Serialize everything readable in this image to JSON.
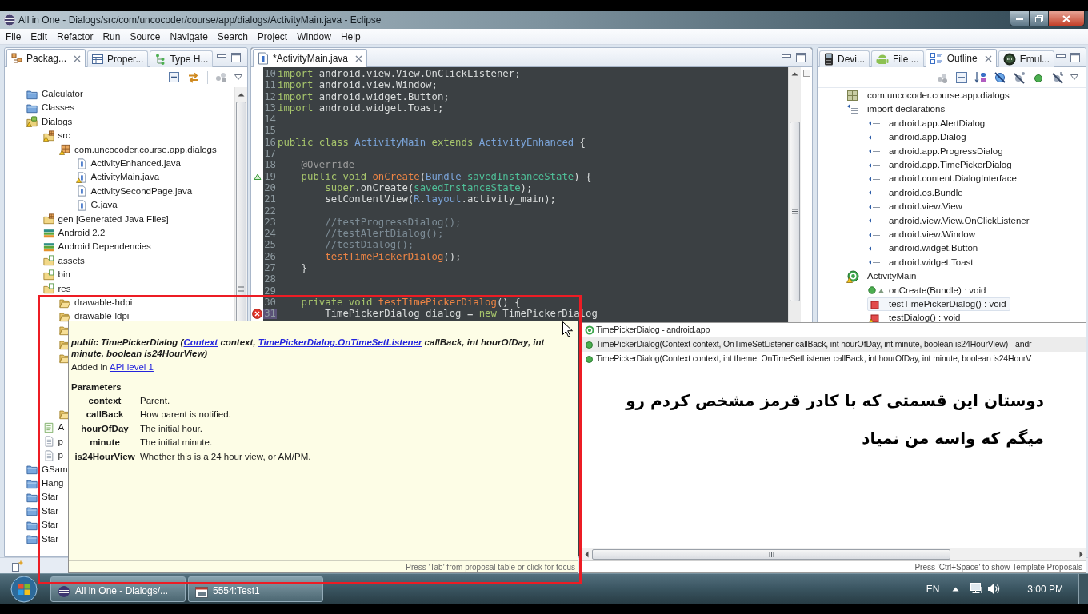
{
  "window": {
    "title": "All in One - Dialogs/src/com/uncocoder/course/app/dialogs/ActivityMain.java - Eclipse"
  },
  "menu_bar": [
    "File",
    "Edit",
    "Refactor",
    "Run",
    "Source",
    "Navigate",
    "Search",
    "Project",
    "Window",
    "Help"
  ],
  "package_explorer": {
    "tabs": [
      {
        "label": "Packag...",
        "kind": "packages",
        "selected": true
      },
      {
        "label": "Proper...",
        "kind": "properties",
        "selected": false
      },
      {
        "label": "Type H...",
        "kind": "hierarchy",
        "selected": false
      }
    ],
    "tree": [
      {
        "label": "Calculator",
        "kind": "project",
        "warning": false
      },
      {
        "label": "Classes",
        "kind": "project",
        "warning": false
      },
      {
        "label": "Dialogs",
        "kind": "android-project",
        "warning": true,
        "children": [
          {
            "label": "src",
            "kind": "source-folder",
            "warning": true,
            "children": [
              {
                "label": "com.uncocoder.course.app.dialogs",
                "kind": "package",
                "warning": true,
                "children": [
                  {
                    "label": "ActivityEnhanced.java",
                    "kind": "java-file",
                    "warning": false
                  },
                  {
                    "label": "ActivityMain.java",
                    "kind": "java-file",
                    "warning": true
                  },
                  {
                    "label": "ActivitySecondPage.java",
                    "kind": "java-file",
                    "warning": false
                  },
                  {
                    "label": "G.java",
                    "kind": "java-file",
                    "warning": false
                  }
                ]
              }
            ]
          },
          {
            "label": "gen [Generated Java Files]",
            "kind": "source-folder",
            "warning": false
          },
          {
            "label": "Android 2.2",
            "kind": "library",
            "warning": false
          },
          {
            "label": "Android Dependencies",
            "kind": "library",
            "warning": false
          },
          {
            "label": "assets",
            "kind": "resource-folder",
            "warning": false
          },
          {
            "label": "bin",
            "kind": "resource-folder",
            "warning": false
          },
          {
            "label": "res",
            "kind": "resource-folder",
            "warning": false,
            "children": [
              {
                "label": "drawable-hdpi",
                "kind": "folder",
                "warning": false
              },
              {
                "label": "drawable-ldpi",
                "kind": "folder",
                "warning": false
              },
              {
                "kind": "folder",
                "warning": false
              },
              {
                "kind": "folder",
                "warning": false
              },
              {
                "kind": "folder",
                "warning": false
              },
              {
                "kind": "folder",
                "warning": false
              }
            ]
          },
          {
            "label": "A",
            "kind": "manifest",
            "warning": false
          },
          {
            "label": "p",
            "kind": "file",
            "warning": false
          },
          {
            "label": "p",
            "kind": "file",
            "warning": false
          }
        ]
      },
      {
        "label": "GSam",
        "kind": "project",
        "warning": false
      },
      {
        "label": "Hang",
        "kind": "project",
        "warning": false
      },
      {
        "label": "Star",
        "kind": "project",
        "warning": false
      },
      {
        "label": "Star",
        "kind": "project",
        "warning": false
      },
      {
        "label": "Star",
        "kind": "project",
        "warning": false
      },
      {
        "label": "Star",
        "kind": "project",
        "warning": false
      }
    ]
  },
  "editor": {
    "tabs": [
      {
        "label": "*ActivityMain.java",
        "kind": "java",
        "selected": true
      }
    ],
    "lines": [
      {
        "number": "10",
        "kind": "normal",
        "current": false,
        "tokens": [
          {
            "text": "import",
            "kind": "keyword"
          },
          {
            "text": " android.view.View.OnClickListener;",
            "kind": "plain"
          }
        ]
      },
      {
        "number": "11",
        "kind": "normal",
        "current": false,
        "tokens": [
          {
            "text": "import",
            "kind": "keyword"
          },
          {
            "text": " android.view.Window;",
            "kind": "plain"
          }
        ]
      },
      {
        "number": "12",
        "kind": "normal",
        "current": false,
        "tokens": [
          {
            "text": "import",
            "kind": "keyword"
          },
          {
            "text": " android.widget.Button;",
            "kind": "plain"
          }
        ]
      },
      {
        "number": "13",
        "kind": "normal",
        "current": false,
        "tokens": [
          {
            "text": "import",
            "kind": "keyword"
          },
          {
            "text": " android.widget.Toast;",
            "kind": "plain"
          }
        ]
      },
      {
        "number": "14",
        "kind": "normal",
        "current": false
      },
      {
        "number": "15",
        "kind": "normal",
        "current": false
      },
      {
        "number": "16",
        "kind": "normal",
        "current": false,
        "tokens": [
          {
            "text": "public class ",
            "kind": "keyword"
          },
          {
            "text": "ActivityMain",
            "kind": "type"
          },
          {
            "text": " extends ",
            "kind": "keyword"
          },
          {
            "text": "ActivityEnhanced",
            "kind": "type"
          },
          {
            "text": " {",
            "kind": "plain"
          }
        ]
      },
      {
        "number": "17",
        "kind": "normal",
        "current": false
      },
      {
        "number": "18",
        "kind": "normal",
        "current": false,
        "tokens": [
          {
            "text": "    @Override",
            "kind": "annotation"
          }
        ]
      },
      {
        "number": "19",
        "kind": "override",
        "current": false,
        "tokens": [
          {
            "text": "    public void ",
            "kind": "keyword"
          },
          {
            "text": "onCreate",
            "kind": "method"
          },
          {
            "text": "(",
            "kind": "plain"
          },
          {
            "text": "Bundle",
            "kind": "type"
          },
          {
            "text": " savedInstanceState",
            "kind": "variable"
          },
          {
            "text": ") {",
            "kind": "plain"
          }
        ]
      },
      {
        "number": "20",
        "kind": "normal",
        "current": false,
        "tokens": [
          {
            "text": "        super",
            "kind": "keyword"
          },
          {
            "text": ".onCreate(",
            "kind": "plain"
          },
          {
            "text": "savedInstanceState",
            "kind": "variable"
          },
          {
            "text": ");",
            "kind": "plain"
          }
        ]
      },
      {
        "number": "21",
        "kind": "normal",
        "current": false,
        "tokens": [
          {
            "text": "        setContentView(",
            "kind": "plain"
          },
          {
            "text": "R",
            "kind": "type"
          },
          {
            "text": ".",
            "kind": "plain"
          },
          {
            "text": "layout",
            "kind": "type"
          },
          {
            "text": ".activity_main);",
            "kind": "plain"
          }
        ]
      },
      {
        "number": "22",
        "kind": "normal",
        "current": false
      },
      {
        "number": "23",
        "kind": "normal",
        "current": false,
        "tokens": [
          {
            "text": "        //testProgressDialog();",
            "kind": "comment"
          }
        ]
      },
      {
        "number": "24",
        "kind": "normal",
        "current": false,
        "tokens": [
          {
            "text": "        //testAlertDialog();",
            "kind": "comment"
          }
        ]
      },
      {
        "number": "25",
        "kind": "normal",
        "current": false,
        "tokens": [
          {
            "text": "        //testDialog();",
            "kind": "comment"
          }
        ]
      },
      {
        "number": "26",
        "kind": "normal",
        "current": false,
        "tokens": [
          {
            "text": "        testTimePickerDialog",
            "kind": "method"
          },
          {
            "text": "();",
            "kind": "plain"
          }
        ]
      },
      {
        "number": "27",
        "kind": "normal",
        "current": false,
        "tokens": [
          {
            "text": "    }",
            "kind": "plain"
          }
        ]
      },
      {
        "number": "28",
        "kind": "normal",
        "current": false
      },
      {
        "number": "29",
        "kind": "normal",
        "current": false
      },
      {
        "number": "30",
        "kind": "normal",
        "current": false,
        "tokens": [
          {
            "text": "    private void ",
            "kind": "keyword"
          },
          {
            "text": "testTimePickerDialog",
            "kind": "method"
          },
          {
            "text": "() {",
            "kind": "plain"
          }
        ]
      },
      {
        "number": "31",
        "kind": "error",
        "current": true,
        "tokens": [
          {
            "text": "        TimePickerDialog dialog = ",
            "kind": "plain"
          },
          {
            "text": "new",
            "kind": "keyword"
          },
          {
            "text": " TimePickerDialog",
            "kind": "plain"
          }
        ]
      }
    ]
  },
  "outline_view": {
    "tabs": [
      {
        "label": "Devi...",
        "kind": "devices",
        "selected": false
      },
      {
        "label": "File ...",
        "kind": "files",
        "selected": false
      },
      {
        "label": "Outline",
        "kind": "outline",
        "selected": true
      },
      {
        "label": "Emul...",
        "kind": "emulator",
        "selected": false
      }
    ],
    "tree": [
      {
        "label": "com.uncocoder.course.app.dialogs",
        "kind": "package",
        "warning": false,
        "selected": false
      },
      {
        "label": "import declarations",
        "kind": "imports",
        "warning": false,
        "selected": false,
        "children": [
          {
            "label": "android.app.AlertDialog",
            "kind": "import",
            "warning": false,
            "selected": false
          },
          {
            "label": "android.app.Dialog",
            "kind": "import",
            "warning": false,
            "selected": false
          },
          {
            "label": "android.app.ProgressDialog",
            "kind": "import",
            "warning": false,
            "selected": false
          },
          {
            "label": "android.app.TimePickerDialog",
            "kind": "import",
            "warning": false,
            "selected": false
          },
          {
            "label": "android.content.DialogInterface",
            "kind": "import",
            "warning": false,
            "selected": false
          },
          {
            "label": "android.os.Bundle",
            "kind": "import",
            "warning": false,
            "selected": false
          },
          {
            "label": "android.view.View",
            "kind": "import",
            "warning": false,
            "selected": false
          },
          {
            "label": "android.view.View.OnClickListener",
            "kind": "import",
            "warning": false,
            "selected": false
          },
          {
            "label": "android.view.Window",
            "kind": "import",
            "warning": false,
            "selected": false
          },
          {
            "label": "android.widget.Button",
            "kind": "import",
            "warning": false,
            "selected": false
          },
          {
            "label": "android.widget.Toast",
            "kind": "import",
            "warning": false,
            "selected": false
          }
        ]
      },
      {
        "label": "ActivityMain",
        "kind": "class",
        "warning": true,
        "selected": false,
        "children": [
          {
            "label": "onCreate(Bundle) : void",
            "kind": "overriding-method",
            "warning": false,
            "selected": false
          },
          {
            "label": "testTimePickerDialog() : void",
            "kind": "private-method",
            "warning": false,
            "selected": true
          },
          {
            "label": "testDialog() : void",
            "kind": "private-method",
            "warning": true,
            "selected": false
          }
        ]
      }
    ]
  },
  "javadoc_popup": {
    "signature": [
      {
        "text": "public TimePickerDialog (",
        "kind": "text"
      },
      {
        "text": "Context",
        "kind": "link"
      },
      {
        "text": " context, ",
        "kind": "text"
      },
      {
        "text": "TimePickerDialog.OnTimeSetListener",
        "kind": "link"
      },
      {
        "text": " callBack, int hourOfDay, int minute, boolean is24HourView)",
        "kind": "text"
      }
    ],
    "availability": [
      {
        "text": "Added in ",
        "kind": "text"
      },
      {
        "text": "API level 1",
        "kind": "link"
      }
    ],
    "parameters_heading": "Parameters",
    "parameters": [
      {
        "name": "context",
        "description": "Parent."
      },
      {
        "name": "callBack",
        "description": "How parent is notified."
      },
      {
        "name": "hourOfDay",
        "description": "The initial hour."
      },
      {
        "name": "minute",
        "description": "The initial minute."
      },
      {
        "name": "is24HourView",
        "description": "Whether this is a 24 hour view, or AM/PM."
      }
    ],
    "footer": "Press 'Tab' from proposal table or click for focus"
  },
  "proposals_popup": {
    "items": [
      {
        "text": "TimePickerDialog - android.app",
        "kind": "class",
        "selected": false
      },
      {
        "text": "TimePickerDialog(Context context, OnTimeSetListener callBack, int hourOfDay, int minute, boolean is24HourView) - andr",
        "kind": "constructor",
        "selected": true
      },
      {
        "text": "TimePickerDialog(Context context, int theme, OnTimeSetListener callBack, int hourOfDay, int minute, boolean is24HourV",
        "kind": "constructor",
        "selected": false
      }
    ],
    "footer": "Press 'Ctrl+Space' to show Template Proposals"
  },
  "annotation": {
    "text": "دوستان این قسمتی که با کادر قرمز مشخص کردم رو\nمیگم که واسه من نمیاد"
  },
  "taskbar": {
    "buttons": [
      {
        "label": "All in One - Dialogs/...",
        "kind": "ide"
      },
      {
        "label": "5554:Test1",
        "kind": "emulator"
      }
    ],
    "language": "EN",
    "clock": "3:00 PM"
  }
}
